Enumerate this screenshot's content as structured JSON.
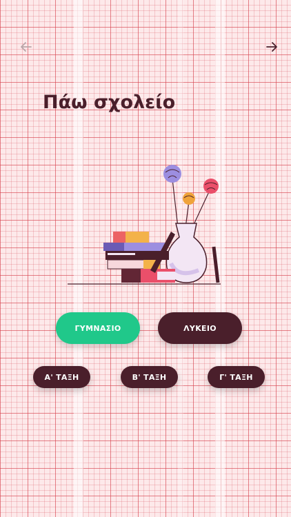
{
  "nav": {
    "back_icon": "arrow-left-icon",
    "forward_icon": "arrow-right-icon"
  },
  "title": "Πάω σχολείο",
  "illustration": "books-and-vase-illustration",
  "school_buttons": [
    {
      "label": "ΓΥΜΝΑΣΙΟ",
      "selected": true
    },
    {
      "label": "ΛΥΚΕΙΟ",
      "selected": false
    }
  ],
  "class_buttons": [
    {
      "label": "Α' ΤΑΞΗ"
    },
    {
      "label": "Β' ΤΑΞΗ"
    },
    {
      "label": "Γ' ΤΑΞΗ"
    }
  ],
  "colors": {
    "accent_green": "#20c88a",
    "maroon": "#4a1f2b",
    "grid": "#d6414d"
  }
}
